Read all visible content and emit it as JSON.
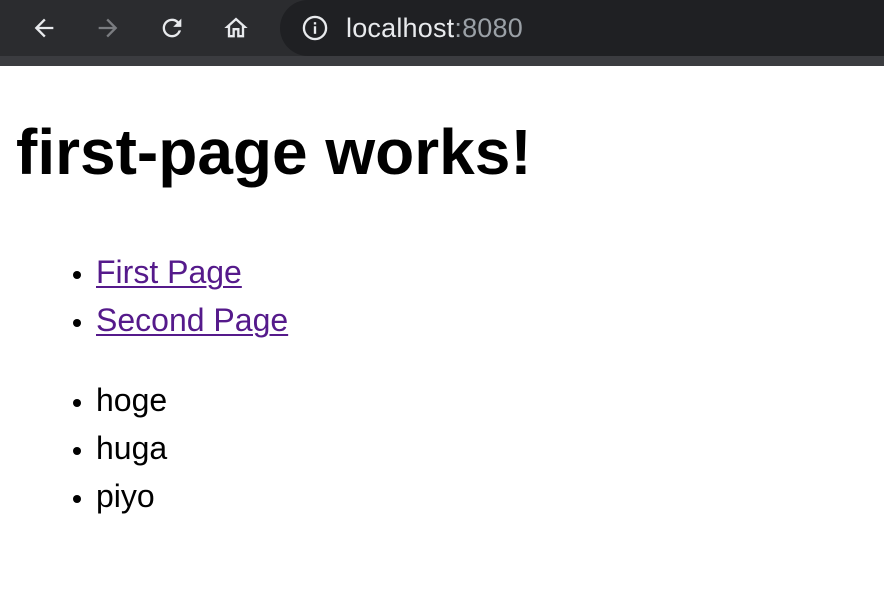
{
  "browser": {
    "url_host": "localhost",
    "url_port": ":8080",
    "icons": {
      "back": "arrow-left-icon",
      "forward": "arrow-right-icon",
      "reload": "reload-icon",
      "home": "home-icon",
      "info": "info-icon"
    }
  },
  "page": {
    "heading": "first-page works!",
    "links": [
      {
        "label": "First Page"
      },
      {
        "label": "Second Page"
      }
    ],
    "items": [
      "hoge",
      "huga",
      "piyo"
    ]
  },
  "colors": {
    "toolbar_bg": "#2b2c2f",
    "omnibox_bg": "#1f2023",
    "link_visited": "#551a8b"
  }
}
